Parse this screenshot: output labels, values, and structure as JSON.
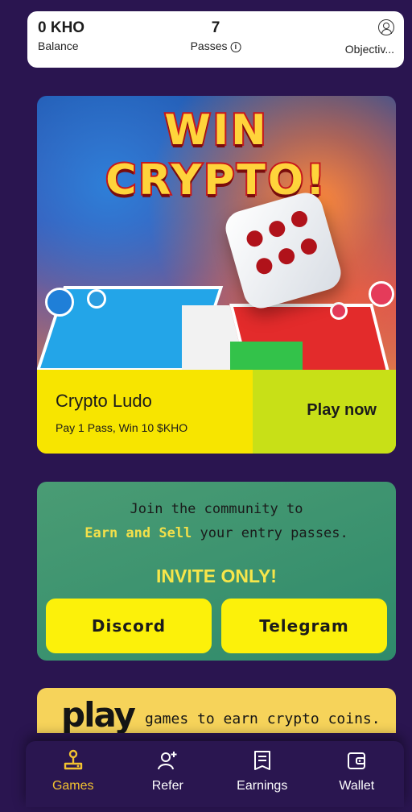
{
  "stats": {
    "balance_value": "0 KHO",
    "balance_label": "Balance",
    "passes_value": "7",
    "passes_label": "Passes",
    "objectives_label": "Objectiv..."
  },
  "game_card": {
    "title_line1": "WIN",
    "title_line2": "CRYPTO!",
    "game_name": "Crypto Ludo",
    "game_desc": "Pay 1 Pass, Win 10 $KHO",
    "play_label": "Play now"
  },
  "community": {
    "line1": "Join the community to",
    "highlight": "Earn and Sell",
    "line2_rest": " your entry passes.",
    "invite": "INVITE ONLY!",
    "discord_label": "Discord",
    "telegram_label": "Telegram"
  },
  "banner": {
    "play_word": "play",
    "tagline": "games to earn crypto coins."
  },
  "nav": {
    "games": "Games",
    "refer": "Refer",
    "earnings": "Earnings",
    "wallet": "Wallet"
  },
  "colors": {
    "background": "#2a1550",
    "accent_yellow": "#fcf10a",
    "active_nav": "#f2c230",
    "community_green": "#3a9470"
  }
}
